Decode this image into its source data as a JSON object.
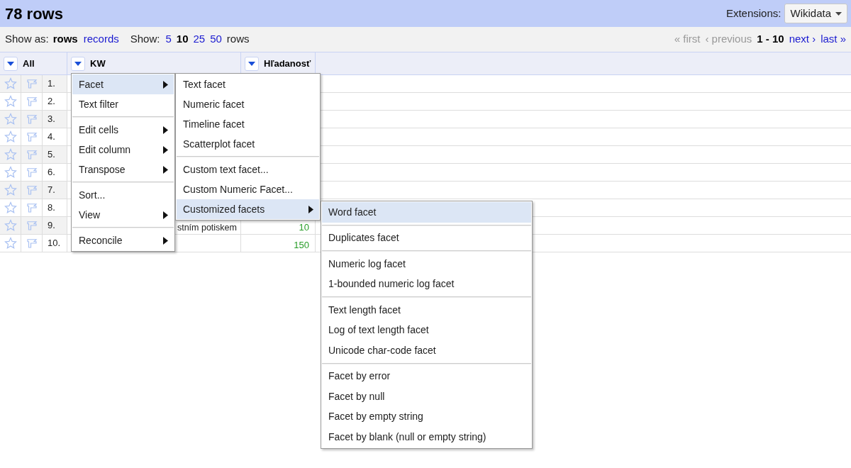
{
  "header": {
    "title": "78 rows",
    "extensions_label": "Extensions:",
    "extensions_button": "Wikidata"
  },
  "toolbar": {
    "show_as_label": "Show as:",
    "modes": [
      {
        "label": "rows",
        "selected": true
      },
      {
        "label": "records",
        "selected": false
      }
    ],
    "show_label": "Show:",
    "page_sizes": [
      {
        "label": "5",
        "selected": false
      },
      {
        "label": "10",
        "selected": true
      },
      {
        "label": "25",
        "selected": false
      },
      {
        "label": "50",
        "selected": false
      }
    ],
    "rows_label": "rows",
    "pager": [
      {
        "label": "« first",
        "disabled": true
      },
      {
        "label": "‹ previous",
        "disabled": true
      },
      {
        "label": "1 - 10",
        "kind": "range"
      },
      {
        "label": "next ›",
        "disabled": false
      },
      {
        "label": "last »",
        "disabled": false
      }
    ]
  },
  "table": {
    "columns": [
      {
        "name": "All"
      },
      {
        "name": "KW"
      },
      {
        "name": "Hľadanosť"
      }
    ],
    "rows": [
      {
        "number": "1."
      },
      {
        "number": "2."
      },
      {
        "number": "3."
      },
      {
        "number": "4."
      },
      {
        "number": "5."
      },
      {
        "number": "6."
      },
      {
        "number": "7."
      },
      {
        "number": "8."
      },
      {
        "number": "9.",
        "kw": "stním potiskem",
        "hladanost": "10"
      },
      {
        "number": "10.",
        "hladanost": "150"
      }
    ]
  },
  "column_menu": {
    "groups": [
      [
        {
          "label": "Facet",
          "selected": true,
          "submenu": true
        },
        {
          "label": "Text filter",
          "selected": false,
          "submenu": false
        }
      ],
      [
        {
          "label": "Edit cells",
          "selected": false,
          "submenu": true
        },
        {
          "label": "Edit column",
          "selected": false,
          "submenu": true
        },
        {
          "label": "Transpose",
          "selected": false,
          "submenu": true
        }
      ],
      [
        {
          "label": "Sort...",
          "selected": false,
          "submenu": false
        },
        {
          "label": "View",
          "selected": false,
          "submenu": true
        }
      ],
      [
        {
          "label": "Reconcile",
          "selected": false,
          "submenu": true
        }
      ]
    ]
  },
  "facet_menu": {
    "groups": [
      [
        {
          "label": "Text facet",
          "selected": false,
          "submenu": false
        },
        {
          "label": "Numeric facet",
          "selected": false,
          "submenu": false
        },
        {
          "label": "Timeline facet",
          "selected": false,
          "submenu": false
        },
        {
          "label": "Scatterplot facet",
          "selected": false,
          "submenu": false
        }
      ],
      [
        {
          "label": "Custom text facet...",
          "selected": false,
          "submenu": false
        },
        {
          "label": "Custom Numeric Facet...",
          "selected": false,
          "submenu": false
        },
        {
          "label": "Customized facets",
          "selected": true,
          "submenu": true
        }
      ]
    ]
  },
  "customized_menu": {
    "groups": [
      [
        {
          "label": "Word facet",
          "selected": true,
          "submenu": false
        }
      ],
      [
        {
          "label": "Duplicates facet",
          "selected": false,
          "submenu": false
        }
      ],
      [
        {
          "label": "Numeric log facet",
          "selected": false,
          "submenu": false
        },
        {
          "label": "1-bounded numeric log facet",
          "selected": false,
          "submenu": false
        }
      ],
      [
        {
          "label": "Text length facet",
          "selected": false,
          "submenu": false
        },
        {
          "label": "Log of text length facet",
          "selected": false,
          "submenu": false
        },
        {
          "label": "Unicode char-code facet",
          "selected": false,
          "submenu": false
        }
      ],
      [
        {
          "label": "Facet by error",
          "selected": false,
          "submenu": false
        },
        {
          "label": "Facet by null",
          "selected": false,
          "submenu": false
        },
        {
          "label": "Facet by empty string",
          "selected": false,
          "submenu": false
        },
        {
          "label": "Facet by blank (null or empty string)",
          "selected": false,
          "submenu": false
        }
      ]
    ]
  }
}
